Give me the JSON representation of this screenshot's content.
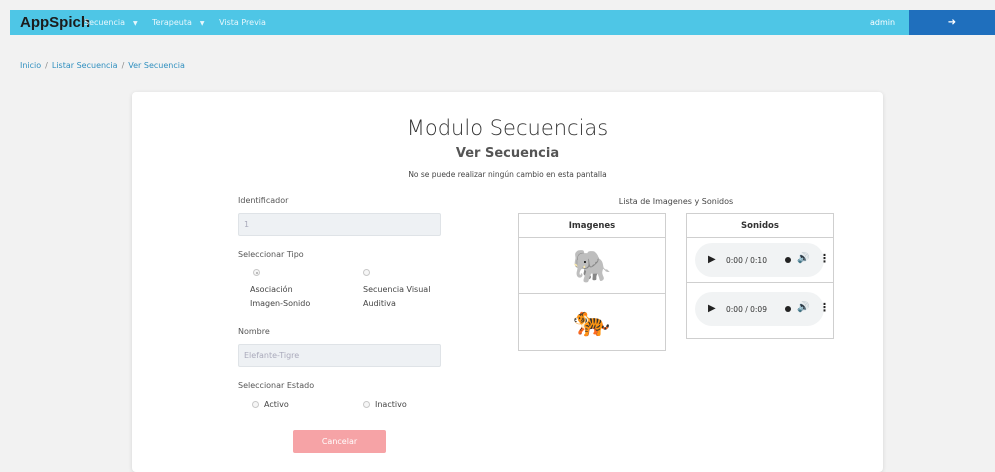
{
  "navbar": {
    "brand": "AppSpich",
    "menu": [
      {
        "label": "Secuencia",
        "caret": "▼"
      },
      {
        "label": "Terapeuta",
        "caret": "▼"
      },
      {
        "label": "Vista Previa",
        "caret": ""
      }
    ],
    "user": "admin",
    "logout_icon": "sign-out-icon",
    "logout_glyph": "➜",
    "colors": {
      "bar": "#4ec6e6",
      "logout": "#1f6fbd"
    }
  },
  "breadcrumb": {
    "items": [
      "Inicio",
      "Listar Secuencia",
      "Ver Secuencia"
    ],
    "separator": "/"
  },
  "page": {
    "title": "Modulo Secuencias",
    "subtitle": "Ver Secuencia",
    "notice": "No se puede realizar ningún cambio en esta pantalla"
  },
  "form": {
    "id_label": "Identificador",
    "id_value": "1",
    "type_label": "Seleccionar Tipo",
    "type_options": [
      {
        "line1": "Asociación",
        "line2": "Imagen-Sonido",
        "checked": true
      },
      {
        "line1": "Secuencia Visual",
        "line2": "Auditiva",
        "checked": false
      }
    ],
    "name_label": "Nombre",
    "name_value": "Elefante-Tigre",
    "state_label": "Seleccionar Estado",
    "state_options": [
      {
        "label": "Activo",
        "checked": false
      },
      {
        "label": "Inactivo",
        "checked": false
      }
    ],
    "cancel_label": "Cancelar",
    "cancel_color": "#f6a3a6"
  },
  "media": {
    "caption": "Lista de Imagenes y Sonidos",
    "images_header": "Imagenes",
    "sounds_header": "Sonidos",
    "images": [
      {
        "icon": "elephant-icon",
        "glyph": "🐘"
      },
      {
        "icon": "tiger-icon",
        "glyph": "🐅"
      }
    ],
    "sounds": [
      {
        "time": "0:00 / 0:10"
      },
      {
        "time": "0:00 / 0:09"
      }
    ],
    "player_glyphs": {
      "play": "▶",
      "volume": "🔊",
      "more": "⋮"
    }
  }
}
